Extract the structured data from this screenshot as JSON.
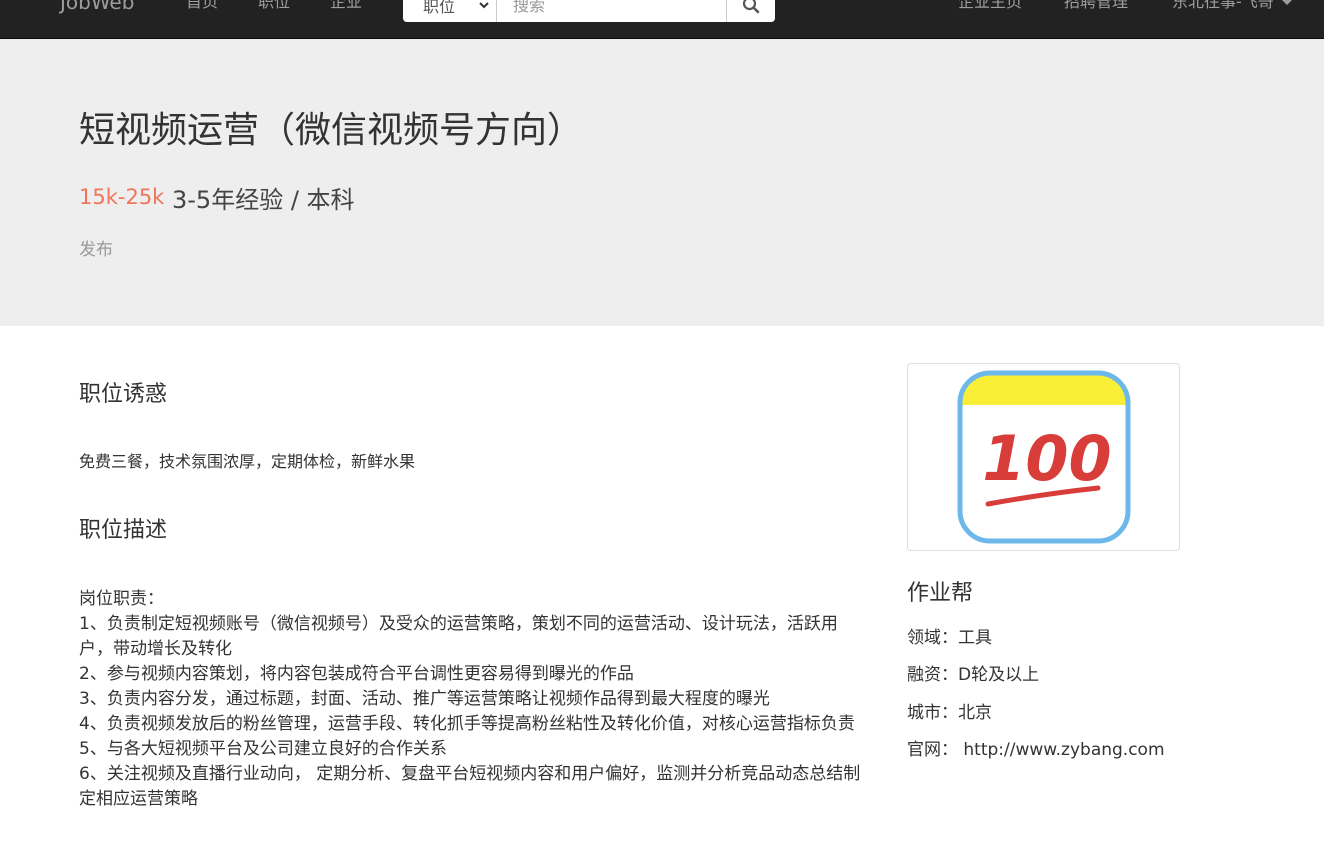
{
  "navbar": {
    "brand": "JobWeb",
    "links": [
      "首页",
      "职位",
      "企业"
    ],
    "search_type": "职位",
    "search_placeholder": "搜索",
    "right_links": [
      "企业主页",
      "招聘管理"
    ],
    "user_menu": "东北往事-飞哥"
  },
  "job": {
    "title": "短视频运营（微信视频号方向）",
    "salary": "15k-25k",
    "requirements": "3-5年经验 / 本科",
    "published": "发布"
  },
  "sections": {
    "perks_heading": "职位诱惑",
    "perks": "免费三餐，技术氛围浓厚，定期体检，新鲜水果",
    "desc_heading": "职位描述",
    "desc_lines": [
      "岗位职责：",
      "1、负责制定短视频账号（微信视频号）及受众的运营策略，策划不同的运营活动、设计玩法，活跃用户，带动增长及转化",
      "2、参与视频内容策划，将内容包装成符合平台调性更容易得到曝光的作品",
      "3、负责内容分发，通过标题，封面、活动、推广等运营策略让视频作品得到最大程度的曝光",
      "4、负责视频发放后的粉丝管理，运营手段、转化抓手等提高粉丝粘性及转化价值，对核心运营指标负责",
      "5、与各大短视频平台及公司建立良好的合作关系",
      "6、关注视频及直播行业动向， 定期分析、复盘平台短视频内容和用户偏好，监测并分析竞品动态总结制定相应运营策略"
    ]
  },
  "company": {
    "logo_text": "100",
    "name": "作业帮",
    "field_label": "领域：",
    "field": "工具",
    "funding_label": "融资：",
    "funding": "D轮及以上",
    "city_label": "城市：",
    "city": "北京",
    "website_label": "官网：",
    "website": "http://www.zybang.com"
  },
  "colors": {
    "navbar_bg": "#222222",
    "jumbotron_bg": "#eeeeee",
    "salary": "#f0755a",
    "logo_yellow": "#f8ef36",
    "logo_blue": "#6cb8ea",
    "logo_red": "#d83d3a"
  }
}
